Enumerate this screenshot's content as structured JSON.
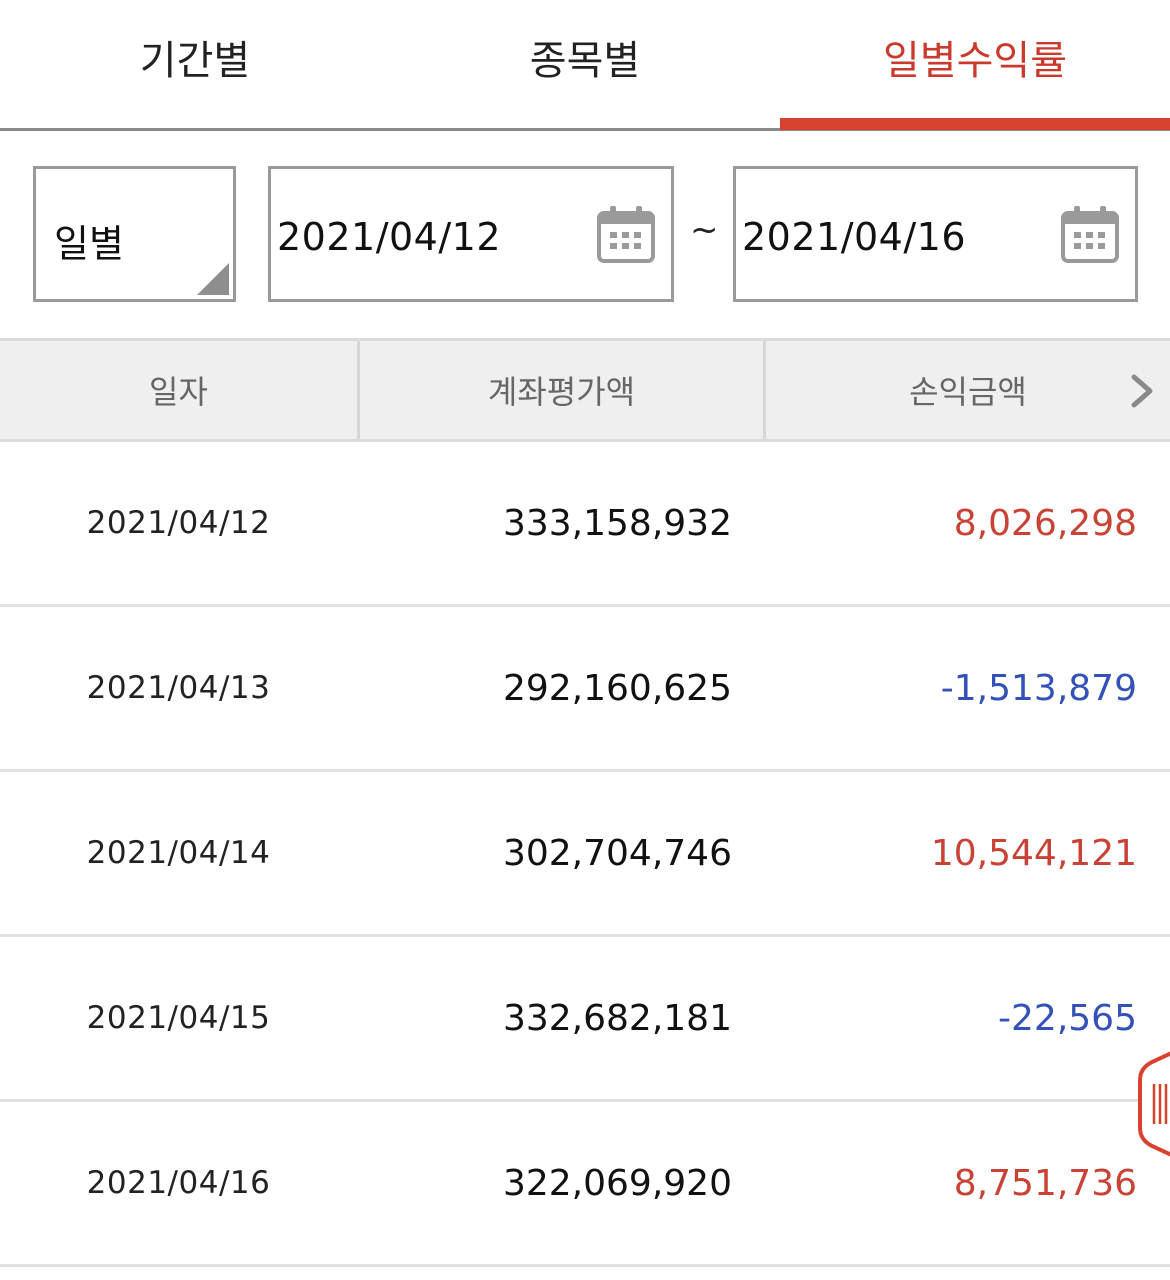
{
  "tabs": [
    {
      "label": "기간별",
      "active": false
    },
    {
      "label": "종목별",
      "active": false
    },
    {
      "label": "일별수익률",
      "active": true
    }
  ],
  "filter": {
    "period": "일별",
    "start_date": "2021/04/12",
    "separator": "~",
    "end_date": "2021/04/16"
  },
  "table": {
    "headers": [
      "일자",
      "계좌평가액",
      "손익금액"
    ],
    "rows": [
      {
        "date": "2021/04/12",
        "evaluation": "333,158,932",
        "profit": "8,026,298",
        "sign": "positive"
      },
      {
        "date": "2021/04/13",
        "evaluation": "292,160,625",
        "profit": "-1,513,879",
        "sign": "negative"
      },
      {
        "date": "2021/04/14",
        "evaluation": "302,704,746",
        "profit": "10,544,121",
        "sign": "positive"
      },
      {
        "date": "2021/04/15",
        "evaluation": "332,682,181",
        "profit": "-22,565",
        "sign": "negative"
      },
      {
        "date": "2021/04/16",
        "evaluation": "322,069,920",
        "profit": "8,751,736",
        "sign": "positive"
      }
    ]
  },
  "colors": {
    "accent": "#d8432f",
    "positive": "#c94236",
    "negative": "#3451b8"
  },
  "icons": {
    "calendar": "calendar-icon",
    "next": "chevron-right-icon",
    "handle": "side-drawer-handle"
  }
}
